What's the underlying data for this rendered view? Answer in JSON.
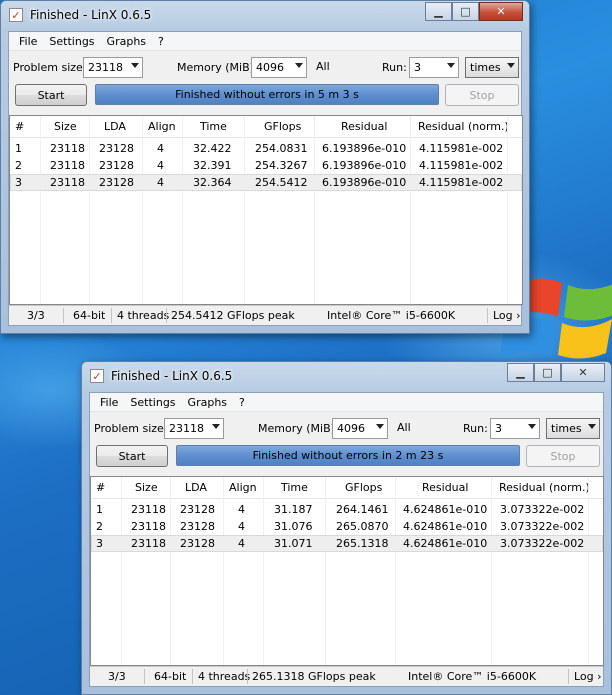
{
  "colors": {
    "desktop": "#1d74c9",
    "progress": "#5f8fcf",
    "close_button": "#c7503b"
  },
  "windows": [
    {
      "title": "Finished - LinX 0.6.5",
      "active": true,
      "menu": [
        "File",
        "Settings",
        "Graphs",
        "?"
      ],
      "problem_size_label": "Problem size:",
      "problem_size": "23118",
      "memory_label": "Memory (MiB):",
      "memory": "4096",
      "all_label": "All",
      "run_label": "Run:",
      "run": "3",
      "times": "times",
      "start": "Start",
      "stop": "Stop",
      "status_text": "Finished without errors in 5 m 3 s",
      "columns": [
        "#",
        "Size",
        "LDA",
        "Align",
        "Time",
        "GFlops",
        "Residual",
        "Residual (norm.)"
      ],
      "rows": [
        [
          "1",
          "23118",
          "23128",
          "4",
          "32.422",
          "254.0831",
          "6.193896e-010",
          "4.115981e-002"
        ],
        [
          "2",
          "23118",
          "23128",
          "4",
          "32.391",
          "254.3267",
          "6.193896e-010",
          "4.115981e-002"
        ],
        [
          "3",
          "23118",
          "23128",
          "4",
          "32.364",
          "254.5412",
          "6.193896e-010",
          "4.115981e-002"
        ]
      ],
      "statusbar": {
        "progress": "3/3",
        "arch": "64-bit",
        "threads": "4 threads",
        "peak": "254.5412 GFlops peak",
        "cpu": "Intel® Core™ i5-6600K",
        "log": "Log ›"
      }
    },
    {
      "title": "Finished - LinX 0.6.5",
      "active": false,
      "menu": [
        "File",
        "Settings",
        "Graphs",
        "?"
      ],
      "problem_size_label": "Problem size:",
      "problem_size": "23118",
      "memory_label": "Memory (MiB):",
      "memory": "4096",
      "all_label": "All",
      "run_label": "Run:",
      "run": "3",
      "times": "times",
      "start": "Start",
      "stop": "Stop",
      "status_text": "Finished without errors in 2 m 23 s",
      "columns": [
        "#",
        "Size",
        "LDA",
        "Align",
        "Time",
        "GFlops",
        "Residual",
        "Residual (norm.)"
      ],
      "rows": [
        [
          "1",
          "23118",
          "23128",
          "4",
          "31.187",
          "264.1461",
          "4.624861e-010",
          "3.073322e-002"
        ],
        [
          "2",
          "23118",
          "23128",
          "4",
          "31.076",
          "265.0870",
          "4.624861e-010",
          "3.073322e-002"
        ],
        [
          "3",
          "23118",
          "23128",
          "4",
          "31.071",
          "265.1318",
          "4.624861e-010",
          "3.073322e-002"
        ]
      ],
      "statusbar": {
        "progress": "3/3",
        "arch": "64-bit",
        "threads": "4 threads",
        "peak": "265.1318 GFlops peak",
        "cpu": "Intel® Core™ i5-6600K",
        "log": "Log ›"
      }
    }
  ]
}
